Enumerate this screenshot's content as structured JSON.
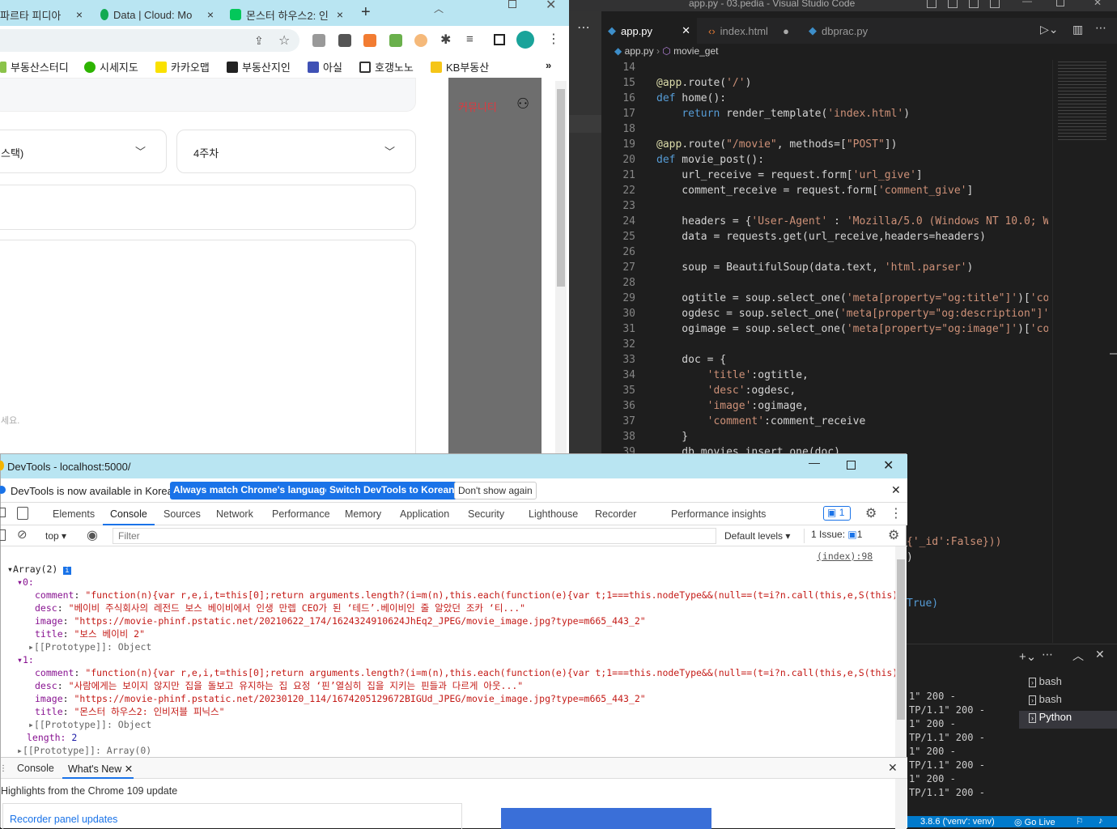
{
  "chrome": {
    "tabs": [
      {
        "label": "파르타 피디아",
        "close": "×"
      },
      {
        "label": "Data | Cloud: Mo",
        "close": "×"
      },
      {
        "label": "몬스터 하우스2: 인",
        "close": "×"
      }
    ],
    "new_tab": "+",
    "bookmarks": [
      "부동산스터디",
      "시세지도",
      "카카오맵",
      "부동산지인",
      "아실",
      "호갱노노",
      "KB부동산"
    ],
    "bookmarks_more": "»",
    "page": {
      "select1": "스택)",
      "select2": "4주차",
      "placeholder_tail": "세요.",
      "nav_community": "커뮤니티"
    }
  },
  "vscode": {
    "title": "app.py - 03.pedia - Visual Studio Code",
    "tabs": [
      {
        "label": "app.py"
      },
      {
        "label": "index.html"
      },
      {
        "label": "dbprac.py"
      }
    ],
    "breadcrumb": {
      "file": "app.py",
      "symbol": "movie_get"
    },
    "code_lines": [
      {
        "n": "14",
        "t": ""
      },
      {
        "n": "15",
        "t": "@app.route('/')"
      },
      {
        "n": "16",
        "t": "def home():"
      },
      {
        "n": "17",
        "t": "    return render_template('index.html')"
      },
      {
        "n": "18",
        "t": ""
      },
      {
        "n": "19",
        "t": "@app.route(\"/movie\", methods=[\"POST\"])"
      },
      {
        "n": "20",
        "t": "def movie_post():"
      },
      {
        "n": "21",
        "t": "    url_receive = request.form['url_give']"
      },
      {
        "n": "22",
        "t": "    comment_receive = request.form['comment_give']"
      },
      {
        "n": "23",
        "t": ""
      },
      {
        "n": "24",
        "t": "    headers = {'User-Agent' : 'Mozilla/5.0 (Windows NT 10.0; Wi"
      },
      {
        "n": "25",
        "t": "    data = requests.get(url_receive,headers=headers)"
      },
      {
        "n": "26",
        "t": ""
      },
      {
        "n": "27",
        "t": "    soup = BeautifulSoup(data.text, 'html.parser')"
      },
      {
        "n": "28",
        "t": ""
      },
      {
        "n": "29",
        "t": "    ogtitle = soup.select_one('meta[property=\"og:title\"]')['con"
      },
      {
        "n": "30",
        "t": "    ogdesc = soup.select_one('meta[property=\"og:description\"]')"
      },
      {
        "n": "31",
        "t": "    ogimage = soup.select_one('meta[property=\"og:image\"]')['con"
      },
      {
        "n": "32",
        "t": ""
      },
      {
        "n": "33",
        "t": "    doc = {"
      },
      {
        "n": "34",
        "t": "        'title':ogtitle,"
      },
      {
        "n": "35",
        "t": "        'desc':ogdesc,"
      },
      {
        "n": "36",
        "t": "        'image':ogimage,"
      },
      {
        "n": "37",
        "t": "        'comment':comment_receive"
      },
      {
        "n": "38",
        "t": "    }"
      },
      {
        "n": "39",
        "t": "    db.movies.insert_one(doc)"
      }
    ],
    "code_tail1": "{'_id':False}))",
    "code_tail2": ")",
    "code_tail3": "True)",
    "terminals": [
      "bash",
      "bash",
      "Python"
    ],
    "term_lines": [
      "1\" 200 -",
      "TP/1.1\" 200 -",
      "1\" 200 -",
      "TP/1.1\" 200 -",
      "1\" 200 -",
      "TP/1.1\" 200 -",
      "1\" 200 -",
      "TP/1.1\" 200 -"
    ],
    "status_python": "3.8.6 ('venv': venv)",
    "status_golive": "Go Live"
  },
  "devtools": {
    "title": "DevTools - localhost:5000/",
    "info_text": "DevTools is now available in Korean!",
    "btn_match": "Always match Chrome's language",
    "btn_switch": "Switch DevTools to Korean",
    "btn_dont": "Don't show again",
    "tabs": [
      "Elements",
      "Console",
      "Sources",
      "Network",
      "Performance",
      "Memory",
      "Application",
      "Security",
      "Lighthouse",
      "Recorder",
      "Performance insights"
    ],
    "issues_badge": "1",
    "context": "top",
    "filter_placeholder": "Filter",
    "levels": "Default levels",
    "issues_count": "1 Issue:",
    "issues_count_num": "1",
    "source_link": "(index):98",
    "log": {
      "header": "Array(2)",
      "items": [
        {
          "idx": "0:",
          "comment": "\"function(n){var r,e,i,t=this[0];return arguments.length?(i=m(n),this.each(function(e){var t;1===this.nodeType&&(null==(t=i?n.call(this,e,S(this).val",
          "desc": "\"베이비 주식회사의 레전드 보스 베이비에서 인생 만렙 CEO가 된 ‘테드’.베이비인 줄 알았던 조카 ‘티...\"",
          "image": "\"https://movie-phinf.pstatic.net/20210622_174/1624324910624JhEq2_JPEG/movie_image.jpg?type=m665_443_2\"",
          "title": "\"보스 베이비 2\""
        },
        {
          "idx": "1:",
          "comment": "\"function(n){var r,e,i,t=this[0];return arguments.length?(i=m(n),this.each(function(e){var t;1===this.nodeType&&(null==(t=i?n.call(this,e,S(this).val",
          "desc": "\"사람에게는 보이지 않지만 집을 돌보고 유지하는 집 요정 ‘핀’열심히 집을 지키는 핀들과 다르게 아웃...\"",
          "image": "\"https://movie-phinf.pstatic.net/20230120_114/1674205129672BIGUd_JPEG/movie_image.jpg?type=m665_443_2\"",
          "title": "\"몬스터 하우스2: 인비저블 피닉스\""
        }
      ],
      "proto": "[[Prototype]]: Object",
      "length_label": "length:",
      "length_val": "2",
      "array_proto": "[[Prototype]]: Array(0)"
    },
    "drawer_tabs": [
      "Console",
      "What's New"
    ],
    "drawer_text": "Highlights from the Chrome 109 update",
    "drawer_link": "Recorder panel updates"
  }
}
